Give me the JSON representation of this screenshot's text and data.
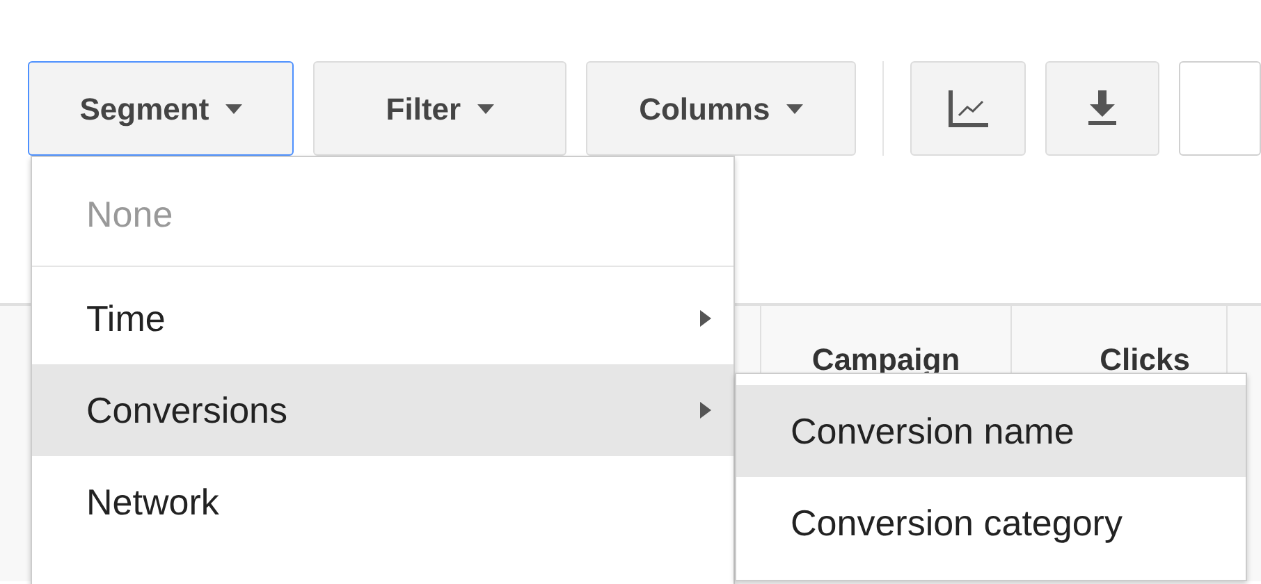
{
  "toolbar": {
    "buttons": [
      {
        "kind": "dropdown",
        "label": "Segment",
        "selected": true
      },
      {
        "kind": "dropdown",
        "label": "Filter",
        "selected": false
      },
      {
        "kind": "dropdown",
        "label": "Columns",
        "selected": false
      },
      {
        "kind": "chart",
        "selected": false
      },
      {
        "kind": "download",
        "selected": false
      }
    ]
  },
  "table": {
    "columns": [
      "Campaign",
      "Clicks"
    ]
  },
  "segment_menu": {
    "items": [
      {
        "label": "None",
        "disabled": true,
        "submenu": false,
        "selected": false
      },
      {
        "label": "Time",
        "disabled": false,
        "submenu": true,
        "selected": false
      },
      {
        "label": "Conversions",
        "disabled": false,
        "submenu": true,
        "selected": true
      },
      {
        "label": "Network",
        "disabled": false,
        "submenu": false,
        "selected": false
      }
    ]
  },
  "submenu": {
    "items": [
      {
        "label": "Conversion name",
        "selected": true
      },
      {
        "label": "Conversion category",
        "selected": false
      }
    ]
  }
}
